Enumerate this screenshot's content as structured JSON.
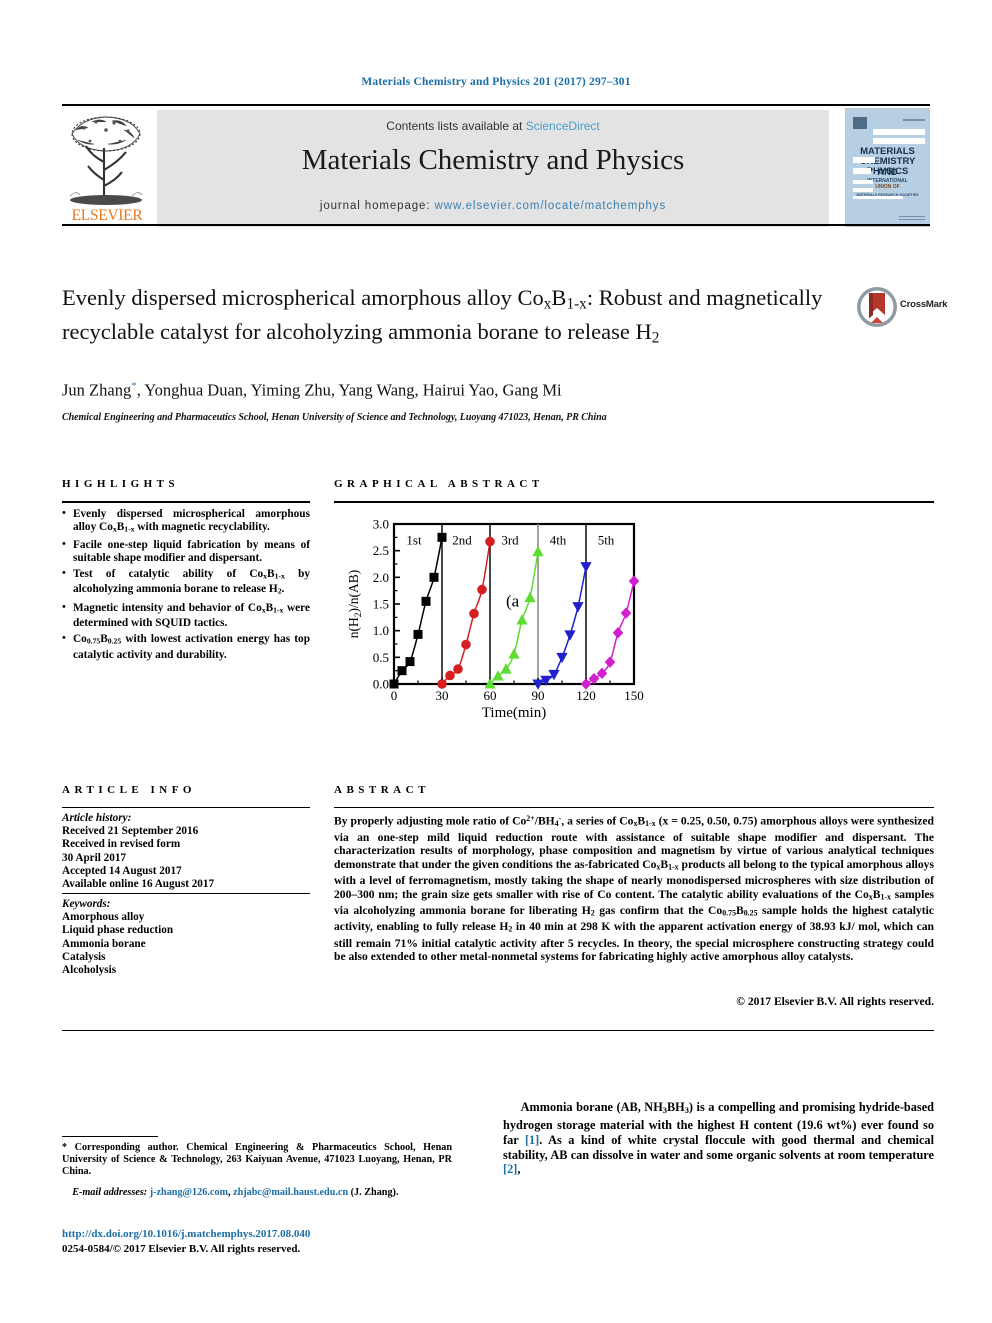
{
  "running_head": "Materials Chemistry and Physics 201 (2017) 297–301",
  "masthead": {
    "contents_prefix": "Contents lists available at ",
    "contents_link": "ScienceDirect",
    "journal_title": "Materials Chemistry and Physics",
    "homepage_prefix": "journal homepage: ",
    "homepage_link": "www.elsevier.com/locate/matchemphys",
    "publisher_logo_text": "ELSEVIER",
    "cover_title_line1": "MATERIALS",
    "cover_title_line2": "CHEMISTRY AND",
    "cover_title_line3": "PHYSICS",
    "cover_sub1": "INTERNATIONAL",
    "cover_sub2": "UNION OF",
    "cover_sub3": "MATERIALS RESEARCH SOCIETIES"
  },
  "article": {
    "title": "Evenly dispersed microspherical amorphous alloy CoxB1-x: Robust and magnetically recyclable catalyst for alcoholyzing ammonia borane to release H2",
    "authors": "Jun Zhang, Yonghua Duan, Yiming Zhu, Yang Wang, Hairui Yao, Gang Mi",
    "affiliation": "Chemical Engineering and Pharmaceutics School, Henan University of Science and Technology, Luoyang 471023, Henan, PR China",
    "crossmark_label": "CrossMark"
  },
  "highlights": {
    "heading": "HIGHLIGHTS",
    "items": [
      "Evenly dispersed microspherical amorphous alloy CoxB1-x with magnetic recyclability.",
      "Facile one-step liquid fabrication by means of suitable shape modifier and dispersant.",
      "Test of catalytic ability of CoxB1-x by alcoholyzing ammonia borane to release H2.",
      "Magnetic intensity and behavior of CoxB1-x were determined with SQUID tactics.",
      "Co0.75B0.25 with lowest activation energy has top catalytic activity and durability."
    ]
  },
  "graphical_abstract": {
    "heading": "GRAPHICAL ABSTRACT"
  },
  "chart_data": {
    "type": "line",
    "title": "",
    "panel_label": "(a",
    "xlabel": "Time(min)",
    "ylabel": "n(H2)/n(AB)",
    "xlim": [
      0,
      150
    ],
    "ylim": [
      0.0,
      3.0
    ],
    "xticks": [
      0,
      30,
      60,
      90,
      120,
      150
    ],
    "yticks": [
      "0.0",
      "0.5",
      "1.0",
      "1.5",
      "2.0",
      "2.5",
      "3.0"
    ],
    "grid": false,
    "legend_position": "in-plot-annotations",
    "cycle_labels": [
      "1st",
      "2nd",
      "3rd",
      "4th",
      "5th"
    ],
    "series": [
      {
        "name": "1st",
        "color": "#000000",
        "marker": "square",
        "x": [
          0,
          5,
          10,
          15,
          20,
          25,
          30
        ],
        "y": [
          0.0,
          0.25,
          0.42,
          0.93,
          1.55,
          2.0,
          2.75
        ]
      },
      {
        "name": "2nd",
        "color": "#d42020",
        "marker": "circle",
        "x": [
          30,
          35,
          40,
          45,
          50,
          55,
          60
        ],
        "y": [
          0.0,
          0.16,
          0.28,
          0.74,
          1.32,
          1.77,
          2.67
        ]
      },
      {
        "name": "3rd",
        "color": "#5fdc32",
        "marker": "triangle-up",
        "x": [
          60,
          65,
          70,
          75,
          80,
          85,
          90
        ],
        "y": [
          0.0,
          0.15,
          0.28,
          0.56,
          1.2,
          1.62,
          2.48
        ]
      },
      {
        "name": "4th",
        "color": "#2020cc",
        "marker": "triangle-down",
        "x": [
          90,
          95,
          100,
          105,
          110,
          115,
          120
        ],
        "y": [
          0.0,
          0.07,
          0.18,
          0.5,
          0.92,
          1.45,
          2.2
        ]
      },
      {
        "name": "5th",
        "color": "#d020d0",
        "marker": "diamond",
        "x": [
          120,
          125,
          130,
          135,
          140,
          145,
          150
        ],
        "y": [
          0.0,
          0.1,
          0.2,
          0.41,
          0.96,
          1.33,
          1.93
        ]
      }
    ]
  },
  "article_info": {
    "heading": "ARTICLE INFO",
    "history_label": "Article history:",
    "history": [
      "Received 21 September 2016",
      "Received in revised form",
      "30 April 2017",
      "Accepted 14 August 2017",
      "Available online 16 August 2017"
    ],
    "keywords_label": "Keywords:",
    "keywords": [
      "Amorphous alloy",
      "Liquid phase reduction",
      "Ammonia borane",
      "Catalysis",
      "Alcoholysis"
    ]
  },
  "abstract": {
    "heading": "ABSTRACT",
    "text": "By properly adjusting mole ratio of Co2+/BH4-, a series of CoxB1-x (x = 0.25, 0.50, 0.75) amorphous alloys were synthesized via an one-step mild liquid reduction route with assistance of suitable shape modifier and dispersant. The characterization results of morphology, phase composition and magnetism by virtue of various analytical techniques demonstrate that under the given conditions the as-fabricated CoxB1-x products all belong to the typical amorphous alloys with a level of ferromagnetism, mostly taking the shape of nearly monodispersed microspheres with size distribution of 200–300 nm; the grain size gets smaller with rise of Co content. The catalytic ability evaluations of the CoxB1-x samples via alcoholyzing ammonia borane for liberating H2 gas confirm that the Co0.75B0.25 sample holds the highest catalytic activity, enabling to fully release H2 in 40 min at 298 K with the apparent activation energy of 38.93 kJ/mol, which can still remain 71% initial catalytic activity after 5 recycles. In theory, the special microsphere constructing strategy could be also extended to other metal-nonmetal systems for fabricating highly active amorphous alloy catalysts.",
    "copyright": "© 2017 Elsevier B.V. All rights reserved."
  },
  "footnotes": {
    "corresponding": "Corresponding author. Chemical Engineering & Pharmaceutics School, Henan University of Science & Technology, 263 Kaiyuan Avenue, 471023 Luoyang, Henan, PR China.",
    "email_label": "E-mail addresses:",
    "email1": "j-zhang@126.com",
    "email2": "zhjabc@mail.haust.edu.cn",
    "email_attrib": "(J. Zhang).",
    "doi": "http://dx.doi.org/10.1016/j.matchemphys.2017.08.040",
    "issn": "0254-0584/© 2017 Elsevier B.V. All rights reserved."
  },
  "body": {
    "paragraph1": "Ammonia borane (AB, NH3BH3) is a compelling and promising hydride-based hydrogen storage material with the highest H content (19.6 wt%) ever found so far [1]. As a kind of white crystal floccule with good thermal and chemical stability, AB can dissolve in water and some organic solvents at room temperature [2],",
    "ref1": "[1]",
    "ref2": "[2]"
  },
  "colors": {
    "link_blue": "#1a6ea8",
    "sciencedirect_blue": "#4a9ec7",
    "elsevier_orange": "#E87722",
    "masthead_gray": "#e3e3e3"
  }
}
